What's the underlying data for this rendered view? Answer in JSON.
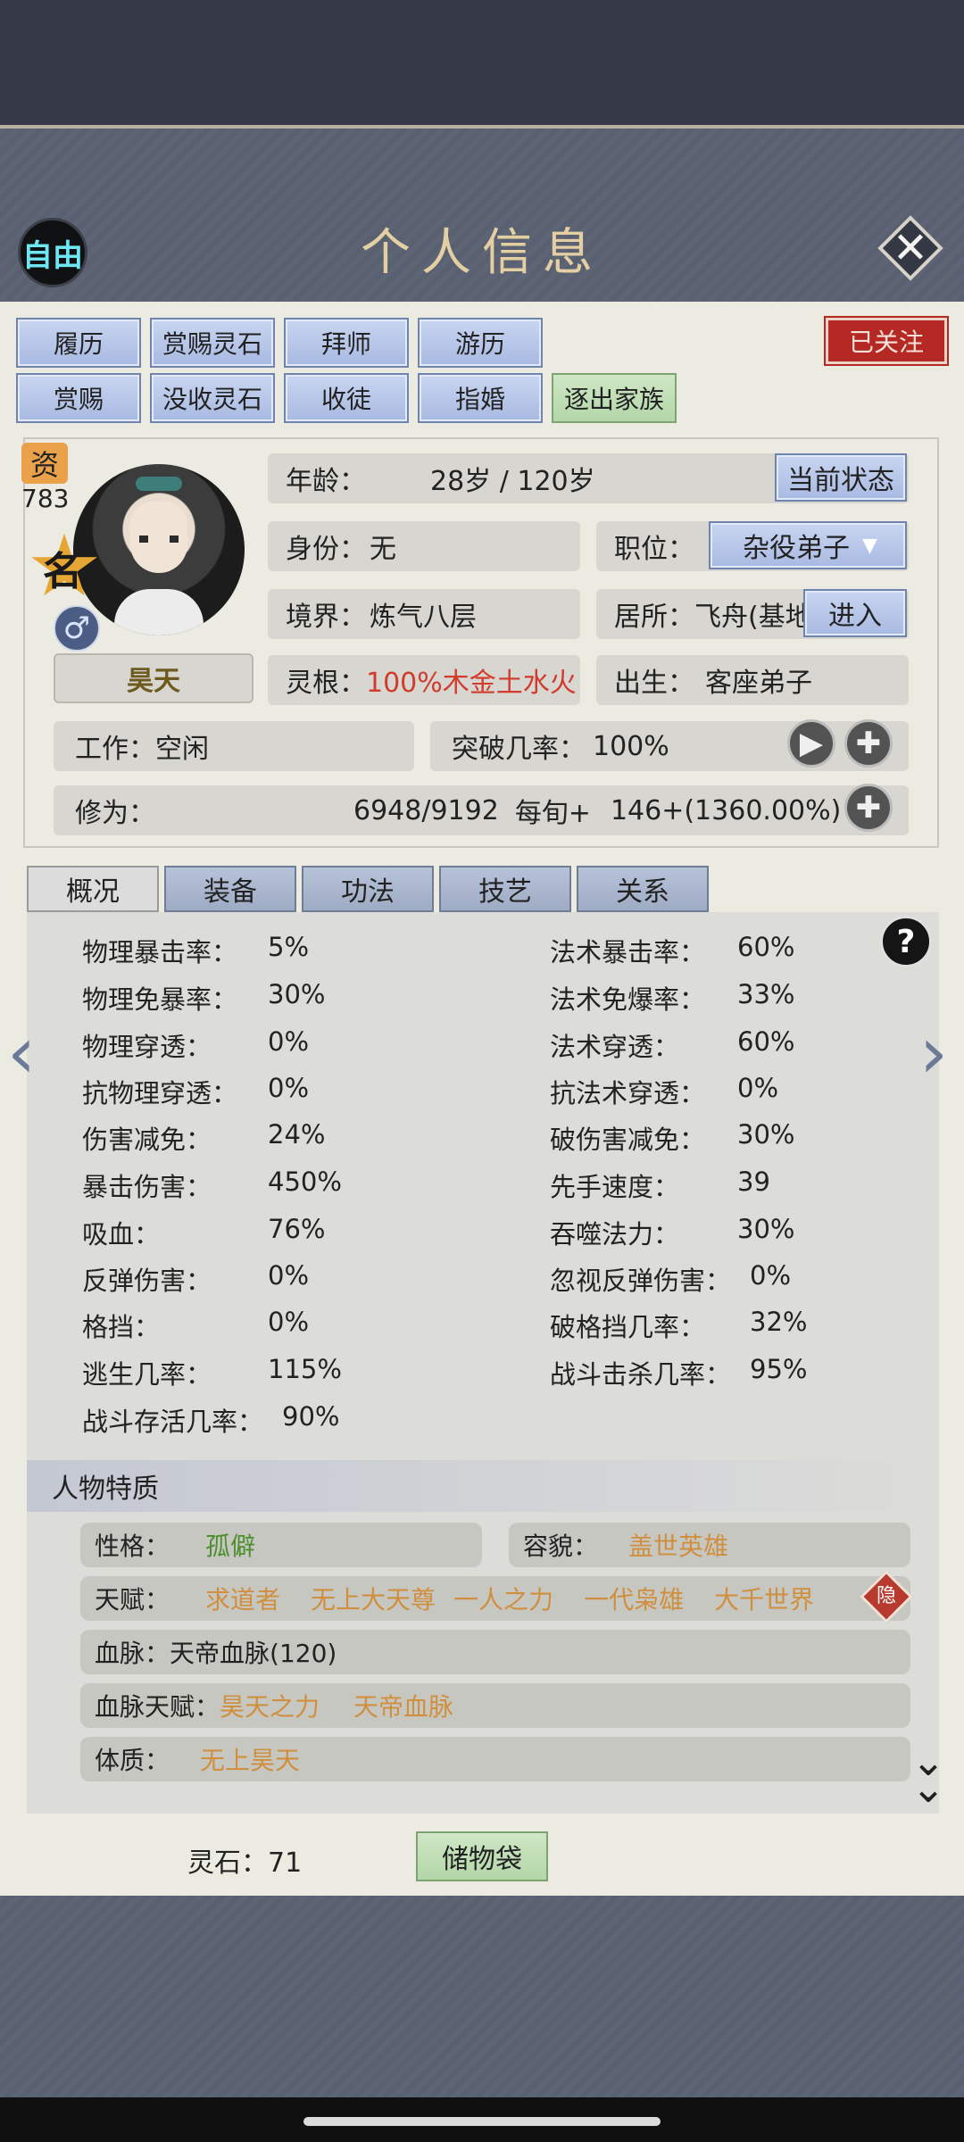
{
  "header": {
    "badge": "自由",
    "title": "个人信息",
    "close": "✕"
  },
  "actions": {
    "row1": [
      "履历",
      "赏赐灵石",
      "拜师",
      "游历"
    ],
    "row2": [
      "赏赐",
      "没收灵石",
      "收徒",
      "指婚"
    ],
    "expel": "逐出家族",
    "follow": "已关注"
  },
  "profile": {
    "zi_label": "资",
    "zi_value": "783",
    "ming": "名",
    "gender_icon": "♂",
    "name": "昊天",
    "age_label": "年龄：",
    "age_value": "28岁 / 120岁",
    "status_btn": "当前状态",
    "identity_label": "身份：",
    "identity_value": "无",
    "position_label": "职位：",
    "position_value": "杂役弟子",
    "realm_label": "境界：",
    "realm_value": "炼气八层",
    "residence_label": "居所：",
    "residence_value": "飞舟(基地",
    "enter_btn": "进入",
    "root_label": "灵根：",
    "root_value": "100%木金土水火",
    "birth_label": "出生：",
    "birth_value": "客座弟子",
    "work_label": "工作：",
    "work_value": "空闲",
    "breakthrough_label": "突破几率：",
    "breakthrough_value": "100%",
    "cultivation_label": "修为：",
    "cultivation_value": "6948/9192",
    "per_turn_label": "每旬+",
    "per_turn_value": "146+(1360.00%)"
  },
  "tabs": [
    "概况",
    "装备",
    "功法",
    "技艺",
    "关系"
  ],
  "stats_left": [
    {
      "label": "物理暴击率：",
      "value": "5%"
    },
    {
      "label": "物理免暴率：",
      "value": "30%"
    },
    {
      "label": "物理穿透：",
      "value": "0%"
    },
    {
      "label": "抗物理穿透：",
      "value": "0%"
    },
    {
      "label": "伤害减免：",
      "value": "24%"
    },
    {
      "label": "暴击伤害：",
      "value": "450%"
    },
    {
      "label": "吸血：",
      "value": "76%"
    },
    {
      "label": "反弹伤害：",
      "value": "0%"
    },
    {
      "label": "格挡：",
      "value": "0%"
    },
    {
      "label": "逃生几率：",
      "value": "115%"
    },
    {
      "label": "战斗存活几率：",
      "value": "90%"
    }
  ],
  "stats_right": [
    {
      "label": "法术暴击率：",
      "value": "60%"
    },
    {
      "label": "法术免爆率：",
      "value": "33%"
    },
    {
      "label": "法术穿透：",
      "value": "60%"
    },
    {
      "label": "抗法术穿透：",
      "value": "0%"
    },
    {
      "label": "破伤害减免：",
      "value": "30%"
    },
    {
      "label": "先手速度：",
      "value": "39"
    },
    {
      "label": "吞噬法力：",
      "value": "30%"
    },
    {
      "label": "忽视反弹伤害：",
      "value": "0%"
    },
    {
      "label": "破格挡几率：",
      "value": "32%"
    },
    {
      "label": "战斗击杀几率：",
      "value": "95%"
    }
  ],
  "traits": {
    "section_title": "人物特质",
    "personality_label": "性格：",
    "personality_value": "孤僻",
    "looks_label": "容貌：",
    "looks_value": "盖世英雄",
    "talent_label": "天赋：",
    "talents": [
      "求道者",
      "无上大天尊",
      "一人之力",
      "一代枭雄",
      "大千世界"
    ],
    "hide_label": "隐",
    "bloodline_label": "血脉：",
    "bloodline_value": "天帝血脉(120)",
    "bloodline_talent_label": "血脉天赋：",
    "bloodline_talents": [
      "昊天之力",
      "天帝血脉"
    ],
    "physique_label": "体质：",
    "physique_value": "无上昊天"
  },
  "footer": {
    "stones_label": "灵石：",
    "stones_value": "71",
    "bag_btn": "储物袋"
  },
  "icons": [
    "close-icon",
    "gender-male-icon",
    "play-icon",
    "plus-icon",
    "help-icon",
    "chevron-left-icon",
    "chevron-right-icon",
    "double-chevron-down-icon",
    "dropdown-arrow-icon"
  ],
  "colors": {
    "accent_red": "#b52823",
    "talent_orange": "#d08f3e",
    "personality_green": "#4c8f2c",
    "root_red": "#d13b2b",
    "title_gold": "#e3cfa1"
  }
}
